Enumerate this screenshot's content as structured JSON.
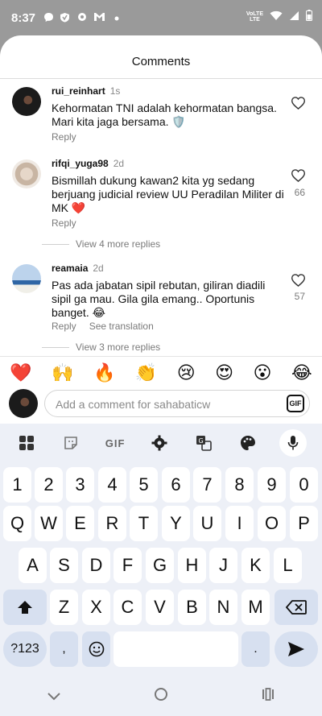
{
  "status_bar": {
    "time": "8:37",
    "network_label_top": "VoLTE",
    "network_label_bottom": "LTE"
  },
  "sheet": {
    "title": "Comments"
  },
  "comments": [
    {
      "username": "rui_reinhart",
      "age": "1s",
      "text": "Kehormatan TNI adalah kehormatan bangsa. Mari kita jaga bersama. 🛡️",
      "reply_label": "Reply",
      "likes": ""
    },
    {
      "username": "rifqi_yuga98",
      "age": "2d",
      "text": "Bismillah dukung kawan2 kita yg sedang berjuang judicial review UU Peradilan Militer di MK ❤️",
      "reply_label": "Reply",
      "likes": "66",
      "more_replies": "View 4 more replies"
    },
    {
      "username": "reamaia",
      "age": "2d",
      "text": "Pas ada jabatan sipil rebutan, giliran diadili sipil ga mau. Gila gila emang.. Oportunis banget. 😂",
      "reply_label": "Reply",
      "translate_label": "See translation",
      "likes": "57",
      "more_replies": "View 3 more replies"
    }
  ],
  "emoji_bar": [
    "❤️",
    "🙌",
    "🔥",
    "👏",
    "😢",
    "😍",
    "😮",
    "😂"
  ],
  "comment_input": {
    "placeholder": "Add a comment for sahabaticw",
    "gif_label": "GIF"
  },
  "keyboard": {
    "toolbar": {
      "gif_label": "GIF"
    },
    "rows": [
      [
        "1",
        "2",
        "3",
        "4",
        "5",
        "6",
        "7",
        "8",
        "9",
        "0"
      ],
      [
        "Q",
        "W",
        "E",
        "R",
        "T",
        "Y",
        "U",
        "I",
        "O",
        "P"
      ],
      [
        "A",
        "S",
        "D",
        "F",
        "G",
        "H",
        "J",
        "K",
        "L"
      ],
      [
        "Z",
        "X",
        "C",
        "V",
        "B",
        "N",
        "M"
      ]
    ],
    "symbols_label": "?123",
    "comma": ",",
    "period": ".",
    "space": ""
  }
}
